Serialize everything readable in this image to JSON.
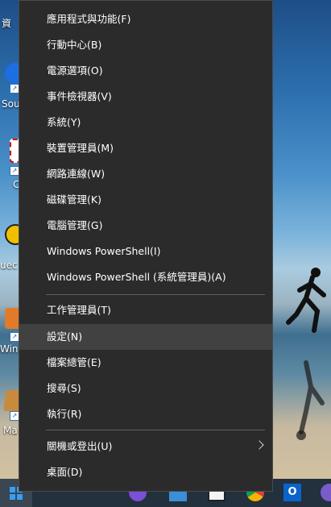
{
  "desktop": {
    "labels": [
      "資",
      "Sou",
      "C",
      "uec",
      "Win",
      "Ma"
    ]
  },
  "menu": {
    "group1": [
      {
        "label": "應用程式與功能(F)"
      },
      {
        "label": "行動中心(B)"
      },
      {
        "label": "電源選項(O)"
      },
      {
        "label": "事件檢視器(V)"
      },
      {
        "label": "系統(Y)"
      },
      {
        "label": "裝置管理員(M)"
      },
      {
        "label": "網路連線(W)"
      },
      {
        "label": "磁碟管理(K)"
      },
      {
        "label": "電腦管理(G)"
      },
      {
        "label": "Windows PowerShell(I)"
      },
      {
        "label": "Windows PowerShell (系統管理員)(A)"
      }
    ],
    "group2": [
      {
        "label": "工作管理員(T)"
      },
      {
        "label": "設定(N)"
      },
      {
        "label": "檔案總管(E)"
      },
      {
        "label": "搜尋(S)"
      },
      {
        "label": "執行(R)"
      }
    ],
    "group3": [
      {
        "label": "關機或登出(U)"
      },
      {
        "label": "桌面(D)"
      }
    ],
    "highlighted_item": "設定(N)"
  },
  "taskbar": {
    "icons": [
      "windows-start-icon",
      "search-icon",
      "task-view-icon",
      "app-icon",
      "store-icon",
      "calculator-icon",
      "chrome-icon",
      "outlook-icon",
      "app-icon"
    ]
  }
}
